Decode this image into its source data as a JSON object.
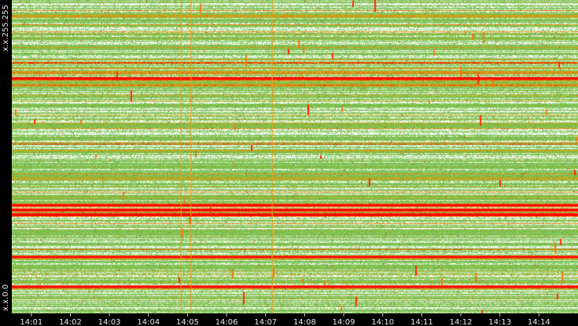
{
  "chart_data": {
    "type": "heatmap",
    "title": "",
    "xlabel": "",
    "ylabel": "",
    "x_ticks": [
      "14:01",
      "14:02",
      "14:03",
      "14:04",
      "14:05",
      "14:06",
      "14:07",
      "14:08",
      "14:09",
      "14:10",
      "14:11",
      "14:12",
      "14:13",
      "14:14"
    ],
    "x_range": [
      "14:00:30",
      "14:15:00"
    ],
    "y_ticks": [
      {
        "label": "x.x.255.255",
        "position": "top"
      },
      {
        "label": "x.x.0.0",
        "position": "bottom"
      }
    ],
    "grid": false,
    "legend": "none",
    "colors": {
      "background": "#000000",
      "low": "#ffffff",
      "mid": "#7cc257",
      "high": "#ff0000",
      "accent": "#e89b1e"
    },
    "intensity_scale": [
      "white",
      "green",
      "orange",
      "red"
    ],
    "hot_bands": [
      {
        "y": 0.685,
        "intensity": 1.0
      },
      {
        "y": 0.67,
        "intensity": 0.95
      },
      {
        "y": 0.655,
        "intensity": 0.9
      },
      {
        "y": 0.915,
        "intensity": 0.9
      },
      {
        "y": 0.82,
        "intensity": 0.85
      },
      {
        "y": 0.25,
        "intensity": 0.9
      },
      {
        "y": 0.23,
        "intensity": 0.8
      },
      {
        "y": 0.27,
        "intensity": 0.75
      },
      {
        "y": 0.82,
        "intensity": 0.7
      },
      {
        "y": 0.57,
        "intensity": 0.7
      },
      {
        "y": 0.48,
        "intensity": 0.6
      },
      {
        "y": 0.05,
        "intensity": 0.75
      }
    ],
    "hot_columns": [
      {
        "x": "14:07:10",
        "intensity": 0.9
      },
      {
        "x": "14:04:50",
        "intensity": 0.85
      },
      {
        "x": "14:05:05",
        "intensity": 0.8
      }
    ]
  }
}
